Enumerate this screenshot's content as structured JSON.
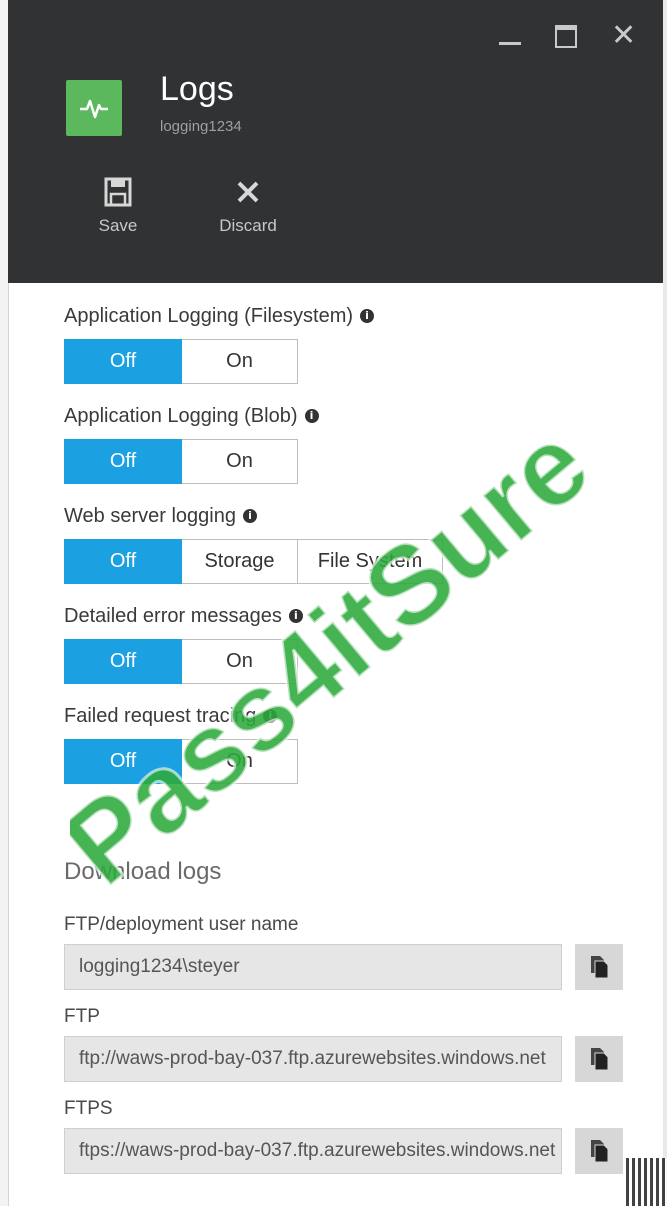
{
  "window": {
    "minimize_icon": "minimize-icon",
    "maximize_icon": "maximize-icon",
    "close_icon": "close-icon"
  },
  "header": {
    "title": "Logs",
    "subtitle": "logging1234",
    "icon": "activity-pulse-icon",
    "commands": [
      {
        "label": "Save",
        "icon": "save-icon"
      },
      {
        "label": "Discard",
        "icon": "discard-icon"
      }
    ]
  },
  "settings": [
    {
      "label": "Application Logging (Filesystem)",
      "options": [
        "Off",
        "On"
      ],
      "selected": "Off"
    },
    {
      "label": "Application Logging (Blob)",
      "options": [
        "Off",
        "On"
      ],
      "selected": "Off"
    },
    {
      "label": "Web server logging",
      "options": [
        "Off",
        "Storage",
        "File System"
      ],
      "selected": "Off"
    },
    {
      "label": "Detailed error messages",
      "options": [
        "Off",
        "On"
      ],
      "selected": "Off"
    },
    {
      "label": "Failed request tracing",
      "options": [
        "Off",
        "On"
      ],
      "selected": "Off"
    }
  ],
  "download": {
    "title": "Download logs",
    "fields": [
      {
        "label": "FTP/deployment user name",
        "value": "logging1234\\steyer"
      },
      {
        "label": "FTP",
        "value": "ftp://waws-prod-bay-037.ftp.azurewebsites.windows.net"
      },
      {
        "label": "FTPS",
        "value": "ftps://waws-prod-bay-037.ftp.azurewebsites.windows.net"
      }
    ]
  },
  "watermark": {
    "text": "Pass4itSure"
  },
  "colors": {
    "header_bg": "#303233",
    "accent": "#1ba1e2",
    "app_tile": "#5cb85c",
    "watermark": "#2eaa3c"
  }
}
